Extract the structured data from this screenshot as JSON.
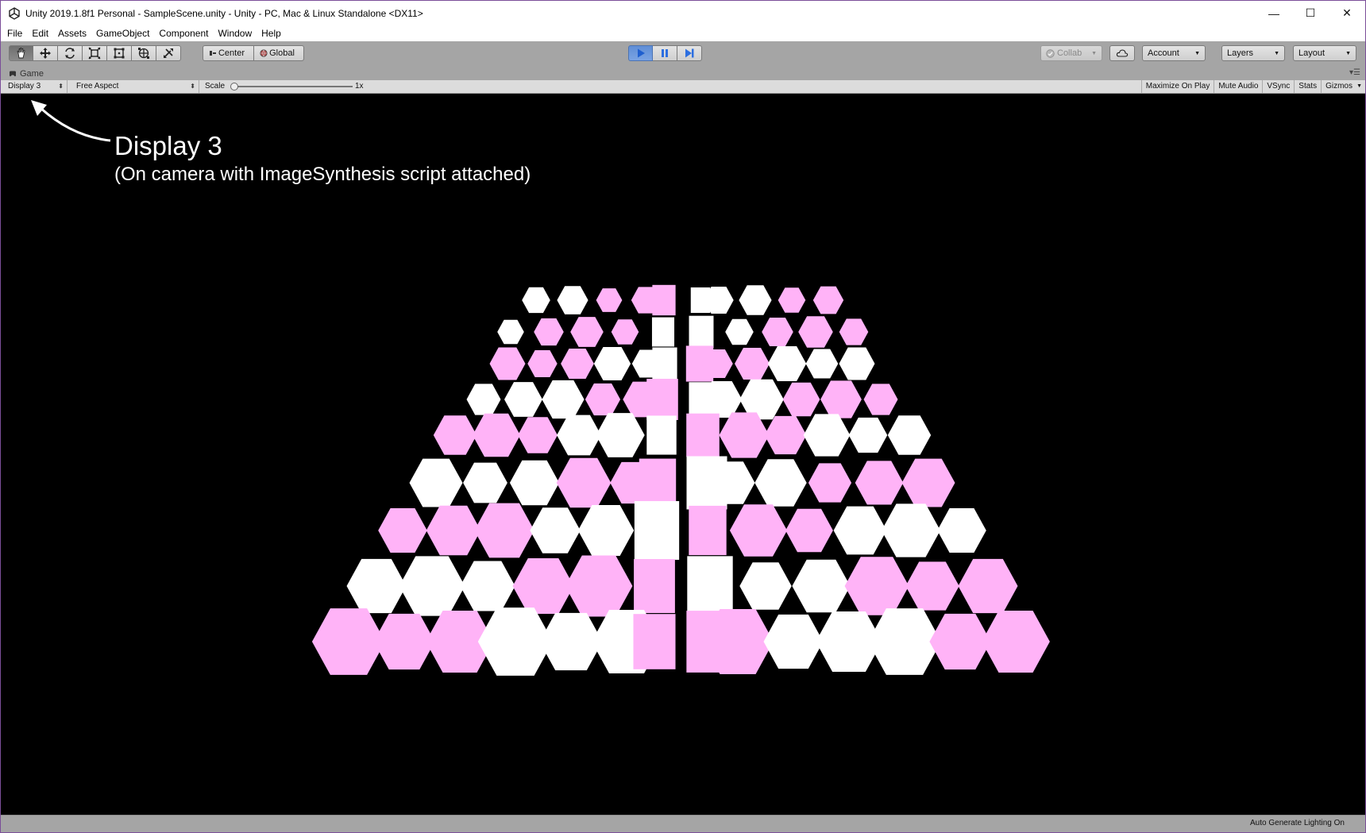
{
  "window": {
    "title": "Unity 2019.1.8f1 Personal - SampleScene.unity - Unity - PC, Mac & Linux Standalone <DX11>",
    "minimize_glyph": "—",
    "maximize_glyph": "☐",
    "close_glyph": "✕"
  },
  "menu": [
    "File",
    "Edit",
    "Assets",
    "GameObject",
    "Component",
    "Window",
    "Help"
  ],
  "toolbar": {
    "tools": [
      {
        "name": "hand-tool",
        "icon": "hand-icon",
        "active": true
      },
      {
        "name": "move-tool",
        "icon": "move-icon",
        "active": false
      },
      {
        "name": "rotate-tool",
        "icon": "rotate-icon",
        "active": false
      },
      {
        "name": "scale-tool",
        "icon": "scale-icon",
        "active": false
      },
      {
        "name": "rect-tool",
        "icon": "rect-icon",
        "active": false
      },
      {
        "name": "transform-tool",
        "icon": "transform-icon",
        "active": false
      },
      {
        "name": "custom-tool",
        "icon": "custom-tool-icon",
        "active": false
      }
    ],
    "pivot_label": "Center",
    "space_label": "Global",
    "collab_label": "Collab",
    "account_label": "Account",
    "layers_label": "Layers",
    "layout_label": "Layout",
    "play_active": true,
    "accent": "#3f7fe0"
  },
  "game_tab": {
    "label": "Game"
  },
  "game_bar": {
    "display": "Display 3",
    "aspect": "Free Aspect",
    "scale_label": "Scale",
    "scale_value": "1x",
    "scale_fraction": 0.0,
    "maximize_on_play": "Maximize On Play",
    "mute_audio": "Mute Audio",
    "vsync": "VSync",
    "stats": "Stats",
    "gizmos": "Gizmos"
  },
  "viewport": {
    "background": "#000000",
    "annotation_title": "Display 3",
    "annotation_subtitle": "(On camera with ImageSynthesis script attached)",
    "object_colors": {
      "pink": "#ffb3f7",
      "white": "#ffffff"
    }
  },
  "status": {
    "text": "Auto Generate Lighting On"
  }
}
